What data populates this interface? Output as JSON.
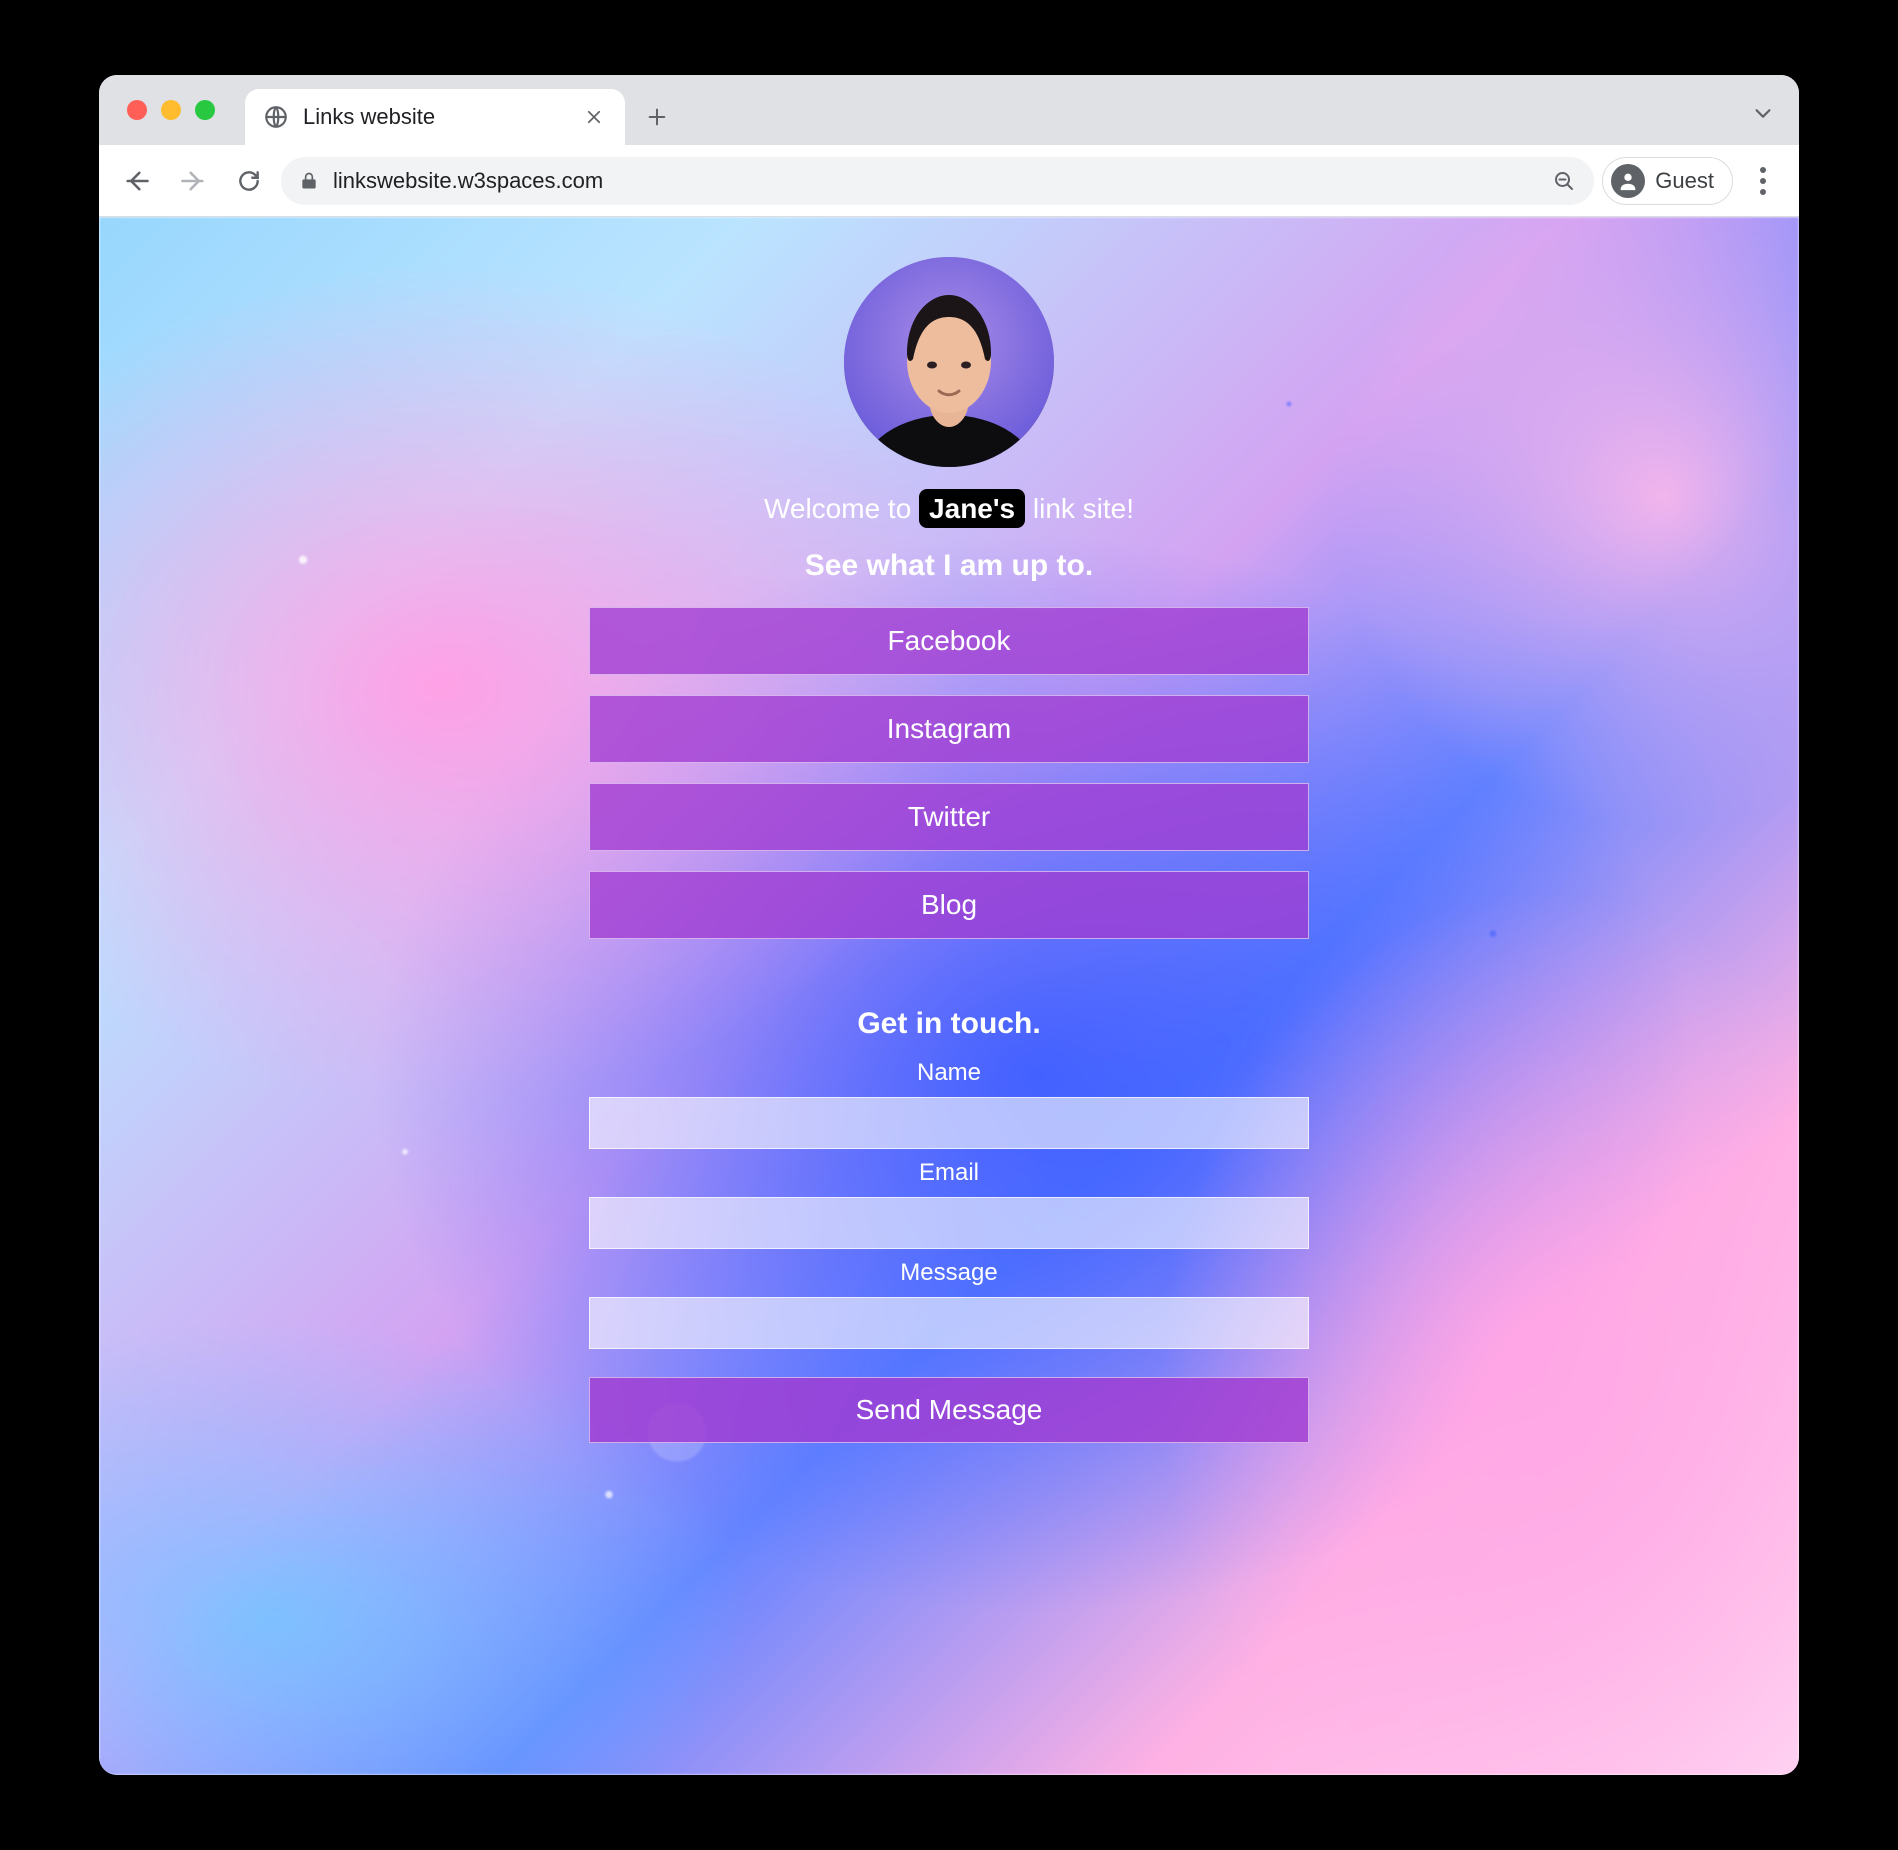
{
  "browser": {
    "tab_title": "Links website",
    "url": "linkswebsite.w3spaces.com",
    "guest_label": "Guest"
  },
  "page": {
    "welcome_prefix": "Welcome to ",
    "welcome_name": "Jane's",
    "welcome_suffix": " link site!",
    "subhead": "See what I am up to.",
    "links": [
      {
        "label": "Facebook"
      },
      {
        "label": "Instagram"
      },
      {
        "label": "Twitter"
      },
      {
        "label": "Blog"
      }
    ],
    "contact_head": "Get in touch.",
    "form": {
      "name_label": "Name",
      "email_label": "Email",
      "message_label": "Message",
      "submit_label": "Send Message"
    }
  },
  "colors": {
    "link_button": "rgba(160,60,210,0.78)"
  }
}
